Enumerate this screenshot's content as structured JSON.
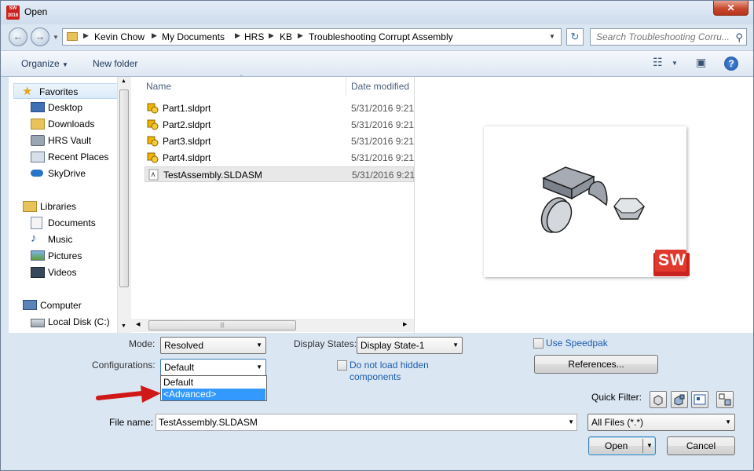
{
  "window": {
    "title": "Open",
    "app_badge": "SW 2016",
    "close_glyph": "✕"
  },
  "address": {
    "crumbs": [
      "Kevin Chow",
      "My Documents",
      "HRS",
      "KB",
      "Troubleshooting Corrupt Assembly"
    ],
    "search_placeholder": "Search Troubleshooting Corru..."
  },
  "toolbar": {
    "organize": "Organize",
    "new_folder": "New folder",
    "help": "?"
  },
  "nav": {
    "favorites": {
      "label": "Favorites",
      "items": [
        "Desktop",
        "Downloads",
        "HRS Vault",
        "Recent Places",
        "SkyDrive"
      ]
    },
    "libraries": {
      "label": "Libraries",
      "items": [
        "Documents",
        "Music",
        "Pictures",
        "Videos"
      ]
    },
    "computer": {
      "label": "Computer",
      "items": [
        "Local Disk (C:)"
      ]
    }
  },
  "filelist": {
    "columns": {
      "name": "Name",
      "date": "Date modified"
    },
    "rows": [
      {
        "name": "Part1.sldprt",
        "date": "5/31/2016 9:21"
      },
      {
        "name": "Part2.sldprt",
        "date": "5/31/2016 9:21"
      },
      {
        "name": "Part3.sldprt",
        "date": "5/31/2016 9:21"
      },
      {
        "name": "Part4.sldprt",
        "date": "5/31/2016 9:21"
      },
      {
        "name": "TestAssembly.SLDASM",
        "date": "5/31/2016 9:21"
      }
    ]
  },
  "preview": {
    "logo_text": "SW"
  },
  "options": {
    "mode_label": "Mode:",
    "mode_value": "Resolved",
    "config_label": "Configurations:",
    "config_value": "Default",
    "config_options": [
      "Default",
      "<Advanced>"
    ],
    "display_states_label": "Display States:",
    "display_state_value": "Display State-1",
    "use_speedpak": "Use Speedpak",
    "do_not_load_line1": "Do not load hidden",
    "do_not_load_line2": "components",
    "references_button": "References...",
    "quick_filter_label": "Quick Filter:"
  },
  "footer": {
    "file_name_label": "File name:",
    "file_name_value": "TestAssembly.SLDASM",
    "file_type_value": "All Files (*.*)",
    "open_button": "Open",
    "cancel_button": "Cancel"
  },
  "colors": {
    "accent": "#3399ff",
    "sw_red": "#c9221f",
    "link": "#1a5ca8"
  }
}
